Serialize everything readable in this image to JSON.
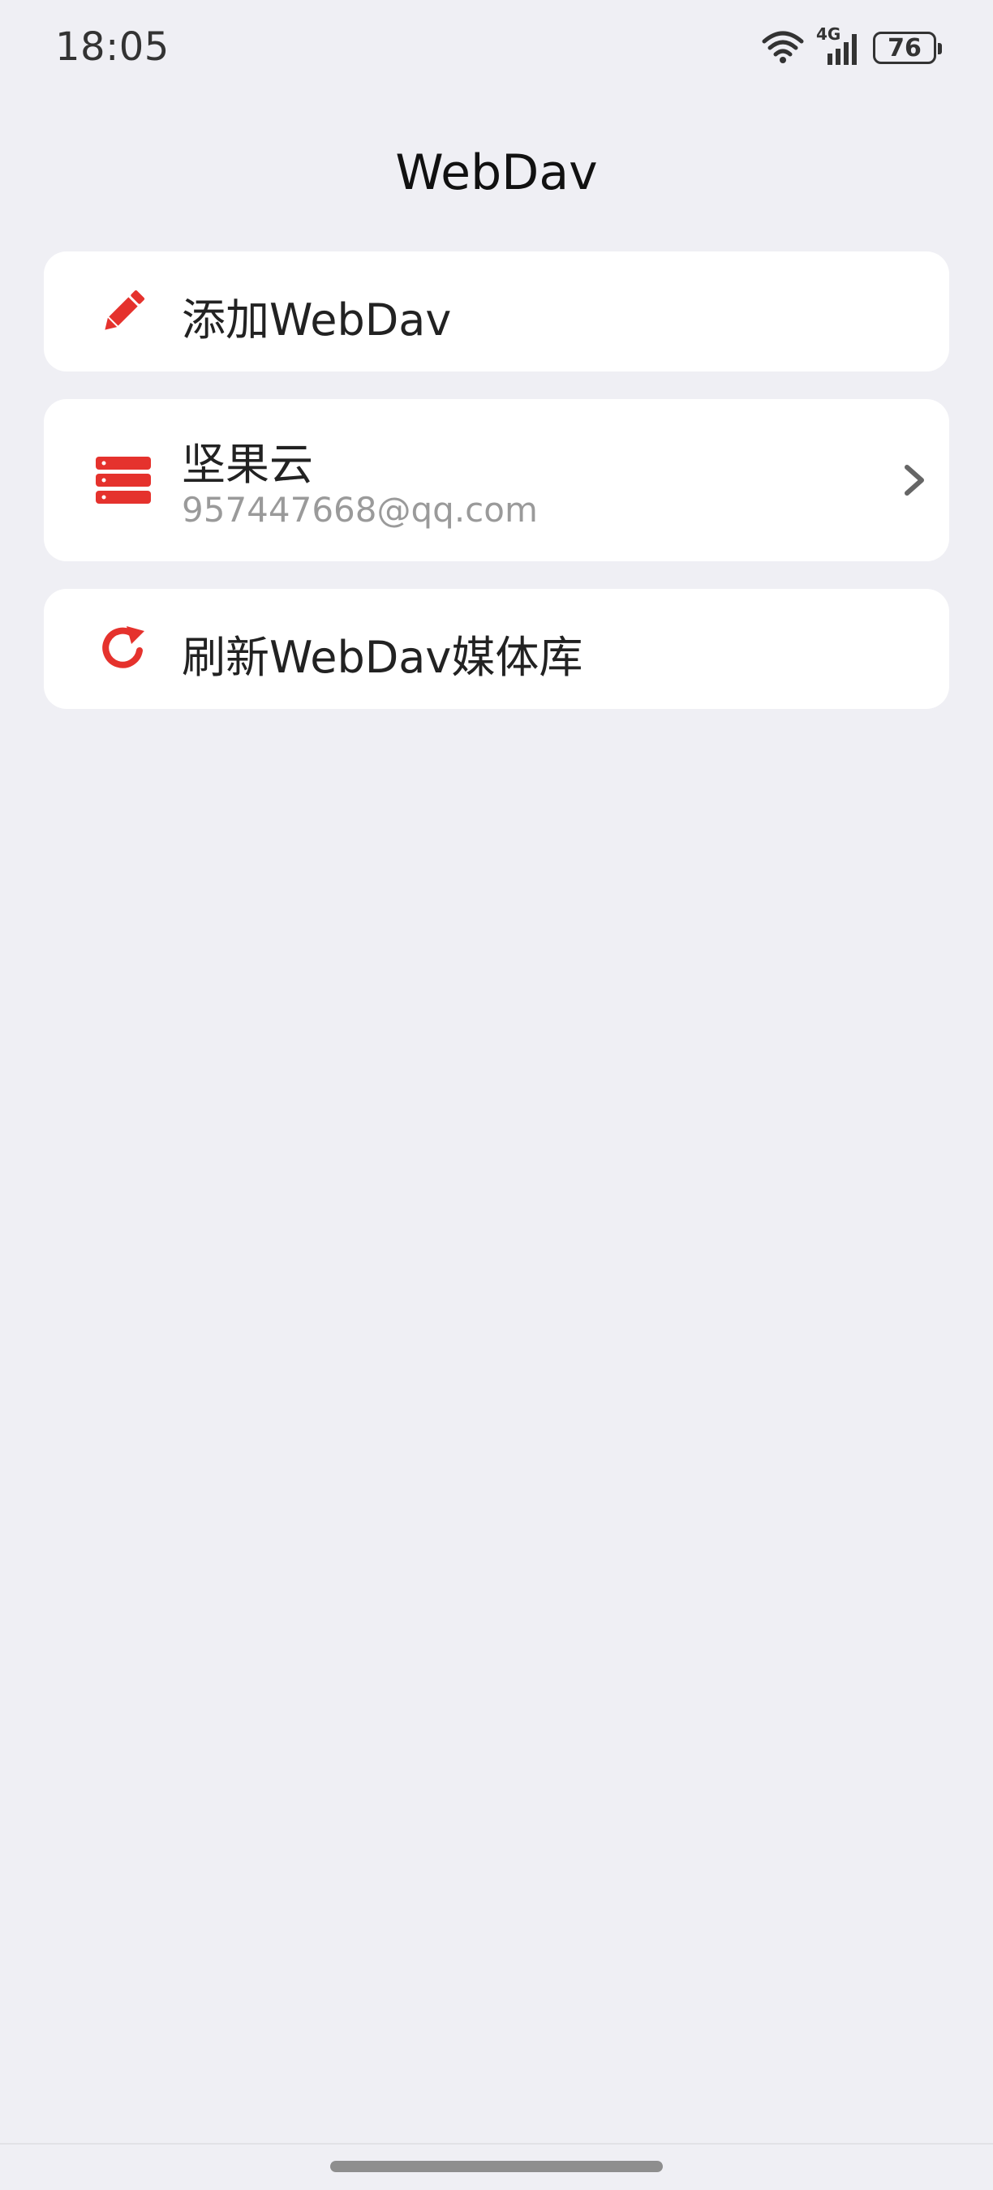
{
  "status_bar": {
    "time": "18:05",
    "network": "4G",
    "battery": "76",
    "icons": [
      "wifi-icon",
      "signal-icon",
      "battery-icon"
    ]
  },
  "header": {
    "title": "WebDav"
  },
  "items": {
    "add": {
      "label": "添加WebDav",
      "icon": "pencil-icon"
    },
    "account": {
      "name": "坚果云",
      "email": "957447668@qq.com",
      "icon": "server-icon",
      "trailing_icon": "chevron-right-icon"
    },
    "refresh": {
      "label": "刷新WebDav媒体库",
      "icon": "refresh-icon"
    }
  },
  "colors": {
    "accent": "#e5322d",
    "background": "#efeff4",
    "card": "#ffffff",
    "secondary_text": "#9a9a9a"
  }
}
